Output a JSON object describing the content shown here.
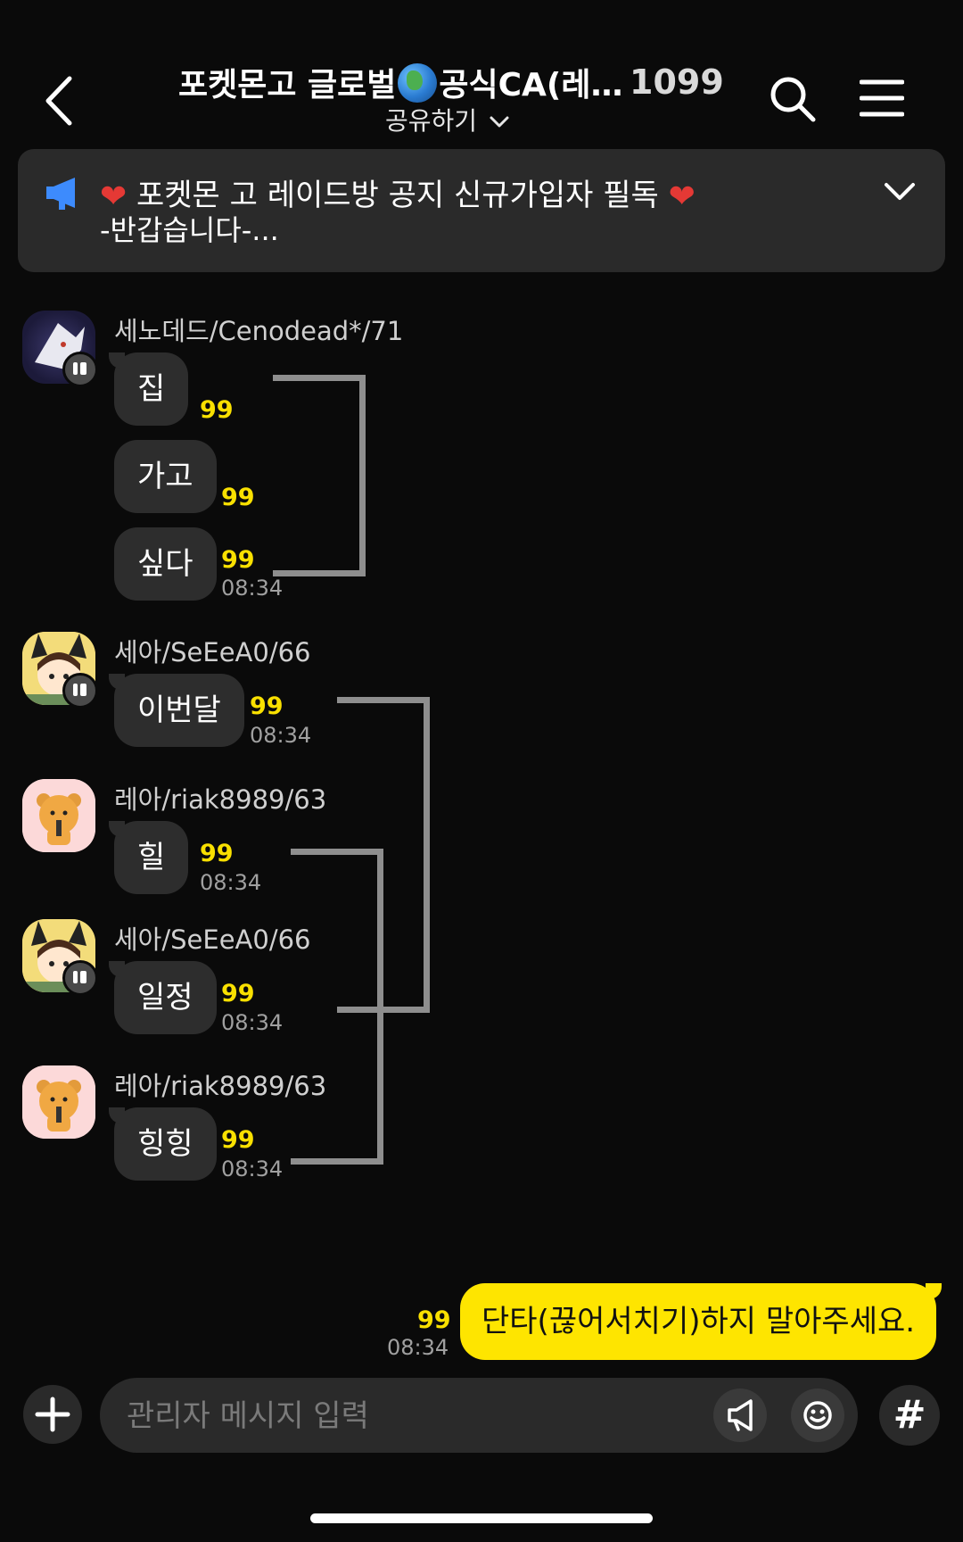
{
  "header": {
    "title_left": "포켓몬고 글로벌",
    "title_right": "공식CA(레…",
    "member_count": "1099",
    "share_label": "공유하기"
  },
  "notice": {
    "line1_text": " 포켓몬 고 레이드방 공지 신규가입자 필독 ",
    "line2": "-반갑습니다-...",
    "heart": "❤"
  },
  "messages": [
    {
      "sender": "세노데드/Cenodead*/71",
      "avatar": "white-pokemon-avatar",
      "bubbles": [
        {
          "text": "집",
          "unread": "99"
        },
        {
          "text": "가고",
          "unread": "99"
        },
        {
          "text": "싶다",
          "unread": "99",
          "time": "08:34"
        }
      ]
    },
    {
      "sender": "세아/SeEeA0/66",
      "avatar": "girl-pikachu-avatar",
      "bubbles": [
        {
          "text": "이번달",
          "unread": "99",
          "time": "08:34"
        }
      ]
    },
    {
      "sender": "레아/riak8989/63",
      "avatar": "ryan-avatar",
      "bubbles": [
        {
          "text": "힐",
          "unread": "99",
          "time": "08:34"
        }
      ]
    },
    {
      "sender": "세아/SeEeA0/66",
      "avatar": "girl-pikachu-avatar",
      "bubbles": [
        {
          "text": "일정",
          "unread": "99",
          "time": "08:34"
        }
      ]
    },
    {
      "sender": "레아/riak8989/63",
      "avatar": "ryan-avatar",
      "bubbles": [
        {
          "text": "힝힝",
          "unread": "99",
          "time": "08:34"
        }
      ]
    }
  ],
  "my_message": {
    "text": "단타(끊어서치기)하지 말아주세요.",
    "unread": "99",
    "time": "08:34"
  },
  "input": {
    "placeholder": "관리자 메시지 입력",
    "hash_label": "#"
  },
  "colors": {
    "background": "#0a0a0a",
    "my_bubble": "#fee500",
    "unread": "#f9e000",
    "bubble": "#2d2d2d"
  }
}
